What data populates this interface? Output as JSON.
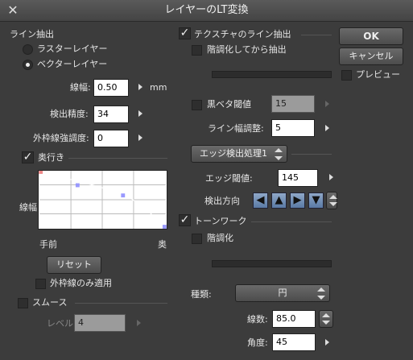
{
  "window": {
    "title": "レイヤーのLT変換",
    "close_glyph": "✕"
  },
  "line_extract": {
    "header": "ライン抽出",
    "raster_label": "ラスターレイヤー",
    "vector_label": "ベクターレイヤー",
    "selected": "vector",
    "line_width_label": "線幅:",
    "line_width_value": "0.50",
    "line_width_unit": "mm",
    "precision_label": "検出精度:",
    "precision_value": "34",
    "outer_label": "外枠線強調度:",
    "outer_value": "0"
  },
  "depth": {
    "checkbox_label": "奥行き",
    "checked": true,
    "y_axis_label": "線幅",
    "x_left_label": "手前",
    "x_right_label": "奥",
    "reset_label": "リセット",
    "outer_only_label": "外枠線のみ適用",
    "curve_points": [
      [
        0,
        1.0
      ],
      [
        0.3,
        0.75
      ],
      [
        0.65,
        0.55
      ],
      [
        1.0,
        0.0
      ]
    ]
  },
  "smooth": {
    "checkbox_label": "スムース",
    "level_label": "レベル:",
    "level_value": "4"
  },
  "texture": {
    "checkbox_label": "テクスチャのライン抽出",
    "checked": true,
    "posterize_label": "階調化してから抽出"
  },
  "black_solid": {
    "checkbox_label": "黒ベタ閾値",
    "value": "15"
  },
  "line_adjust": {
    "label": "ライン幅調整:",
    "value": "5"
  },
  "edge": {
    "dropdown_label": "エッジ検出処理1",
    "threshold_label": "エッジ閾値:",
    "threshold_value": "145",
    "direction_label": "検出方向",
    "direction_glyphs": [
      "◀",
      "▲",
      "▶",
      "▼"
    ]
  },
  "tone": {
    "checkbox_label": "トーンワーク",
    "checked": true,
    "posterize_label": "階調化",
    "type_label": "種類:",
    "type_value": "円",
    "lines_label": "線数:",
    "lines_value": "85.0",
    "angle_label": "角度:",
    "angle_value": "45"
  },
  "buttons": {
    "ok": "OK",
    "cancel": "キャンセル",
    "preview_label": "プレビュー"
  },
  "colors": {
    "accent": "#9090ff",
    "background": "#3c3c3c",
    "dir_button": "#6d8cb5"
  }
}
